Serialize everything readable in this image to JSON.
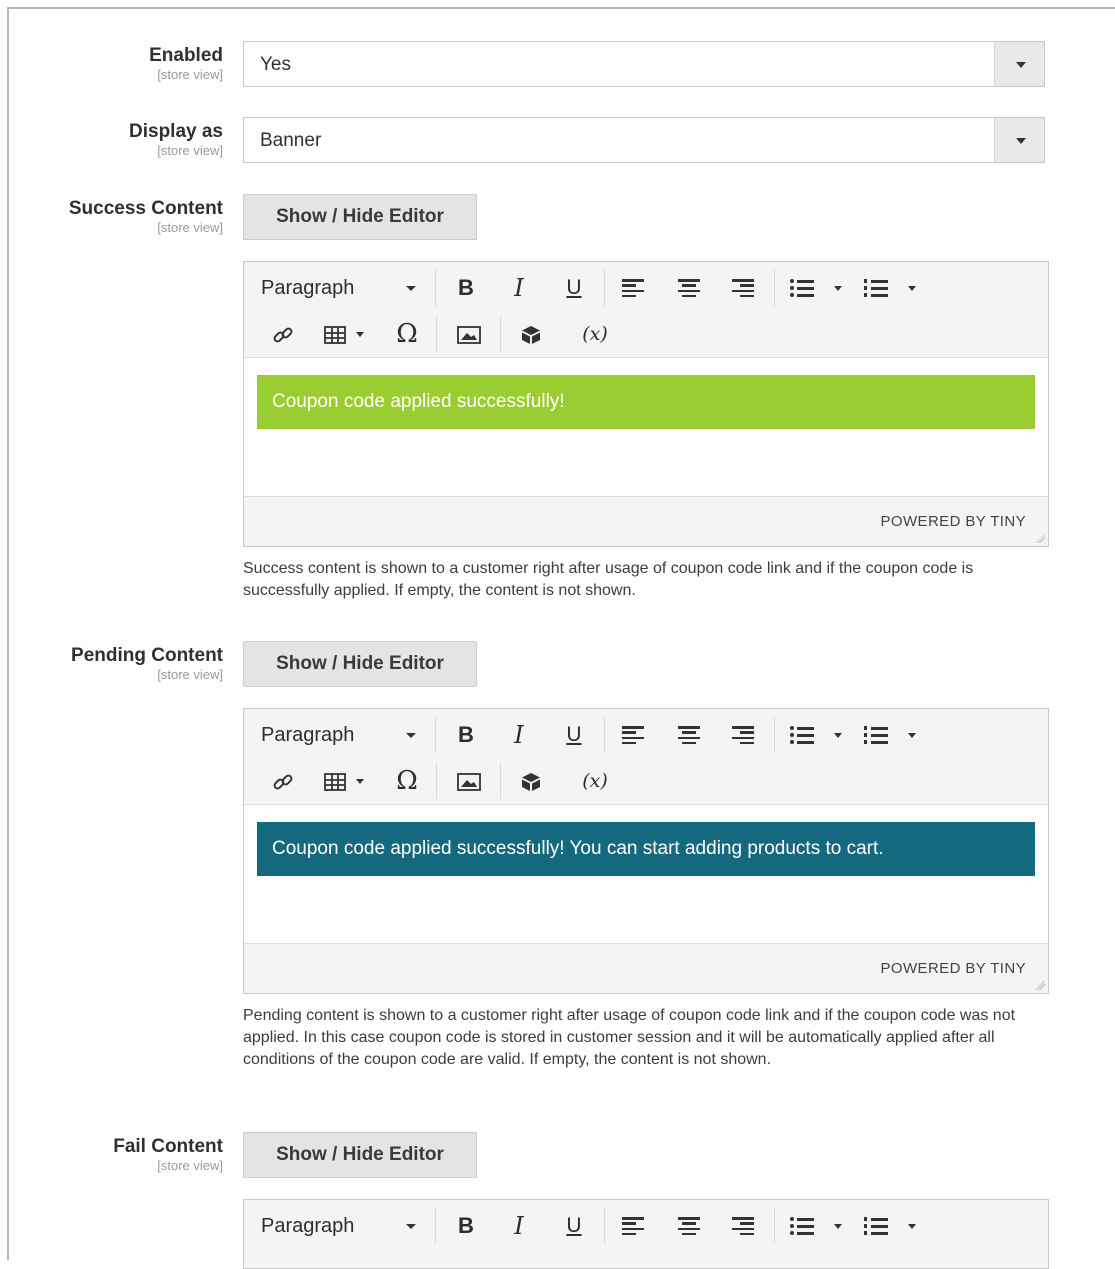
{
  "scope_label": "[store view]",
  "enabled": {
    "label": "Enabled",
    "value": "Yes"
  },
  "display_as": {
    "label": "Display as",
    "value": "Banner"
  },
  "toggle_editor_label": "Show / Hide Editor",
  "toolbar": {
    "block_format": "Paragraph",
    "bold": "B",
    "italic": "I",
    "underline": "U",
    "special_char": "Ω",
    "variables": "(x)",
    "icons": [
      "bold-icon",
      "italic-icon",
      "underline-icon",
      "align-left-icon",
      "align-center-icon",
      "align-right-icon",
      "bullet-list-icon",
      "numbered-list-icon",
      "link-icon",
      "table-icon",
      "special-character-icon",
      "image-icon",
      "widget-icon",
      "variables-icon"
    ]
  },
  "powered_by": "POWERED BY TINY",
  "success": {
    "label": "Success Content",
    "banner_text": "Coupon code applied successfully!",
    "banner_color": "#9acd32",
    "note": "Success content is shown to a customer right after usage of coupon code link and if the coupon code is successfully applied. If empty, the content is not shown."
  },
  "pending": {
    "label": "Pending Content",
    "banner_text": "Coupon code applied successfully! You can start adding products to cart.",
    "banner_color": "#15697f",
    "note": "Pending content is shown to a customer right after usage of coupon code link and if the coupon code was not applied. In this case coupon code is stored in customer session and it will be automatically applied after all conditions of the coupon code are valid. If empty, the content is not shown."
  },
  "fail": {
    "label": "Fail Content"
  }
}
